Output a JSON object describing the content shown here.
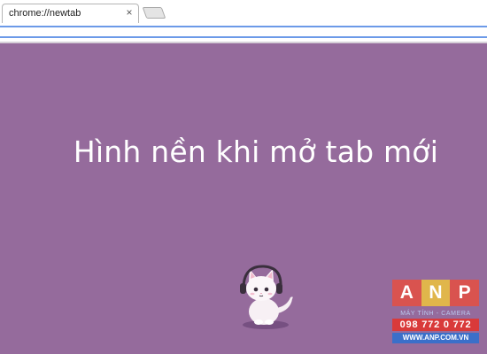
{
  "browser": {
    "tab": {
      "title": "chrome://newtab",
      "close_glyph": "×"
    },
    "new_tab_button": "new-tab-icon"
  },
  "content": {
    "headline": "Hình nền khi mở tab mới",
    "background_color": "#956b9c",
    "illustration": "cat-with-headphones-icon"
  },
  "watermark": {
    "letters": [
      "A",
      "N",
      "P"
    ],
    "letter_colors": [
      "#d9534f",
      "#e0b64b",
      "#d9534f"
    ],
    "tagline": "MÁY TÍNH - CAMERA",
    "phone": "098 772 0 772",
    "website": "WWW.ANP.COM.VN"
  }
}
